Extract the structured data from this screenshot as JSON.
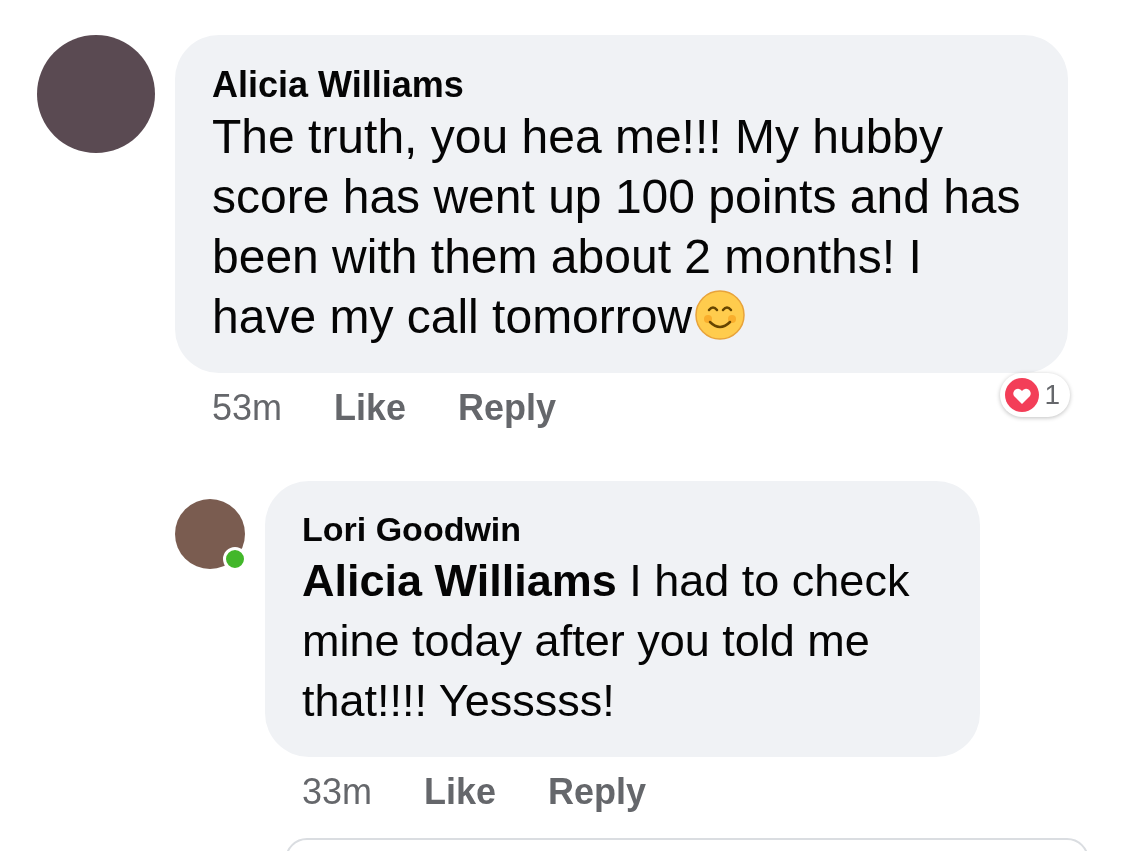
{
  "comments": [
    {
      "author": "Alicia Williams",
      "text": "The truth, you hea me!!! My hubby score has went up 100 points and has been with them about 2 months! I have my call tomorrow",
      "ends_with_emoji": true,
      "online": false,
      "time": "53m",
      "actions": [
        "Like",
        "Reply"
      ],
      "reaction_count": "1",
      "replies": [
        {
          "author": "Lori Goodwin",
          "text": "**Alicia Williams** I had to check mine today after you told me that!!!! Yesssss!",
          "ends_with_emoji": false,
          "online": true,
          "time": "33m",
          "actions": [
            "Like",
            "Reply"
          ]
        }
      ]
    }
  ]
}
